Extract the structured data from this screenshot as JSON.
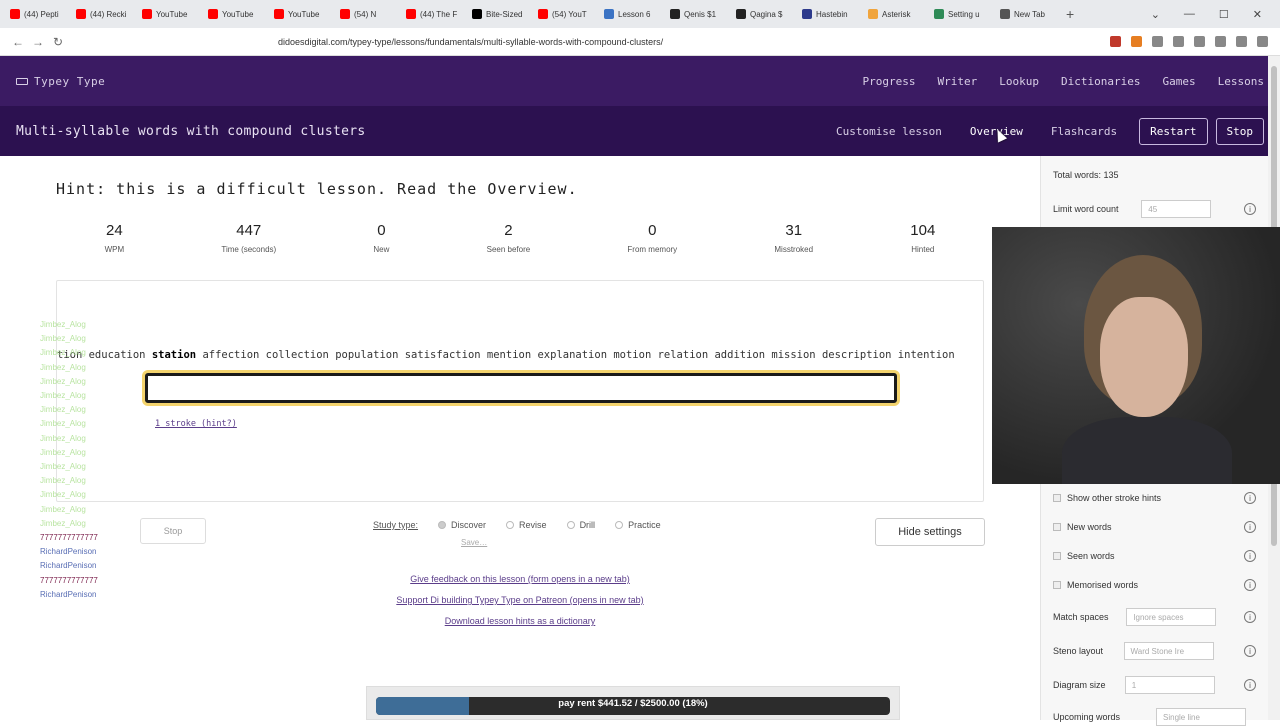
{
  "browser": {
    "tabs": [
      {
        "label": "(44) Pepti",
        "color": "#ff0000"
      },
      {
        "label": "(44) Recki",
        "color": "#ff0000"
      },
      {
        "label": "YouTube",
        "color": "#ff0000"
      },
      {
        "label": "YouTube",
        "color": "#ff0000"
      },
      {
        "label": "YouTube",
        "color": "#ff0000"
      },
      {
        "label": "(54) N",
        "color": "#ff0000"
      },
      {
        "label": "(44) The F",
        "color": "#ff0000"
      },
      {
        "label": "Bite-Sized",
        "color": "#000000"
      },
      {
        "label": "(54) YouT",
        "color": "#ff0000"
      },
      {
        "label": "Lesson 6",
        "color": "#3b73c4"
      },
      {
        "label": "Qenis $1",
        "color": "#222222"
      },
      {
        "label": "Qagina $",
        "color": "#222222"
      },
      {
        "label": "Hastebin",
        "color": "#2d3a8c"
      },
      {
        "label": "Asterisk",
        "color": "#f0a43c"
      },
      {
        "label": "Setting u",
        "color": "#2e8b57"
      },
      {
        "label": "New Tab",
        "color": "#555555"
      }
    ],
    "new_tab": "+",
    "url": "didoesdigital.com/typey-type/lessons/fundamentals/multi-syllable-words-with-compound-clusters/"
  },
  "site": {
    "brand": "Typey Type",
    "nav": [
      "Progress",
      "Writer",
      "Lookup",
      "Dictionaries",
      "Games",
      "Lessons"
    ]
  },
  "lesson": {
    "title": "Multi-syllable words with compound clusters",
    "links": [
      "Customise lesson",
      "Overview",
      "Flashcards"
    ],
    "restart": "Restart",
    "stop": "Stop",
    "hint": "Hint: this is a difficult lesson. Read the Overview.",
    "stats": [
      {
        "value": "24",
        "label": "WPM"
      },
      {
        "value": "447",
        "label": "Time (seconds)"
      },
      {
        "value": "0",
        "label": "New"
      },
      {
        "value": "2",
        "label": "Seen before"
      },
      {
        "value": "0",
        "label": "From memory"
      },
      {
        "value": "31",
        "label": "Misstroked"
      },
      {
        "value": "104",
        "label": "Hinted"
      }
    ],
    "material_before": "tion education",
    "material_current": "station",
    "material_after": "affection collection population satisfaction mention explanation motion relation addition mission description intention",
    "stroke_hint": "1 stroke (hint?)",
    "study_type_label": "Study type:",
    "study_types": [
      "Discover",
      "Revise",
      "Drill",
      "Practice"
    ],
    "save": "Save…",
    "inner_stop": "Stop",
    "hide_settings": "Hide settings",
    "footer_links": [
      "Give feedback on this lesson (form opens in a new tab)",
      "Support Di building Typey Type on Patreon (opens in new tab)",
      "Download lesson hints as a dictionary"
    ],
    "donation": {
      "text": "pay rent $441.52 / $2500.00 (18%)",
      "progress": 0.18
    }
  },
  "chat": {
    "names": [
      "Jimbez_Alog",
      "Jimbez_Alog",
      "Jimbez_Alog",
      "Jimbez_Alog",
      "Jimbez_Alog",
      "Jimbez_Alog",
      "Jimbez_Alog",
      "Jimbez_Alog",
      "Jimbez_Alog",
      "Jimbez_Alog",
      "Jimbez_Alog",
      "Jimbez_Alog",
      "Jimbez_Alog",
      "Jimbez_Alog",
      "Jimbez_Alog",
      "7777777777777",
      "RichardPenison",
      "RichardPenison",
      "7777777777777",
      "RichardPenison"
    ]
  },
  "sidebar": {
    "total_words": "Total words: 135",
    "limit_word_count": "Limit word count",
    "limit_value": "45",
    "show_other_stroke_hints": "Show other stroke hints",
    "new_words": "New words",
    "seen_words": "Seen words",
    "memorised_words": "Memorised words",
    "match_spaces": "Match spaces",
    "match_spaces_value": "Ignore spaces",
    "steno_layout": "Steno layout",
    "steno_layout_value": "Ward Stone Ire",
    "diagram_size": "Diagram size",
    "diagram_size_value": "1",
    "upcoming_words": "Upcoming words",
    "upcoming_words_value": "Single line"
  },
  "colors": {
    "header": "#3b1b63",
    "lesson_bar": "#2c1150",
    "accent": "#5b3d8a",
    "focus": "#f3d36d"
  }
}
